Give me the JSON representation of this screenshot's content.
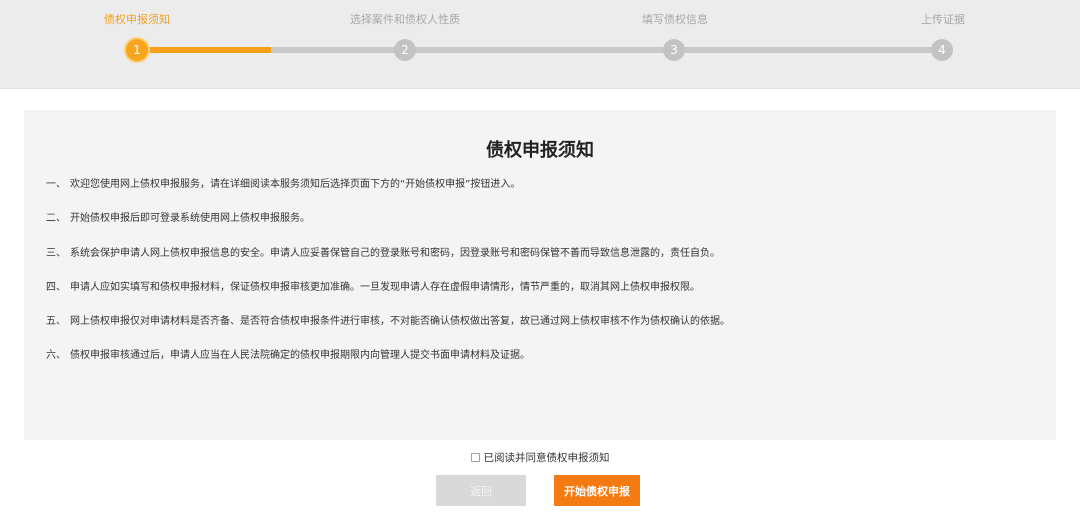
{
  "steps": [
    {
      "label": "债权申报须知",
      "num": "1"
    },
    {
      "label": "选择案件和债权人性质",
      "num": "2"
    },
    {
      "label": "填写债权信息",
      "num": "3"
    },
    {
      "label": "上传证据",
      "num": "4"
    }
  ],
  "current_step": 1,
  "notice": {
    "title": "债权申报须知",
    "items": [
      {
        "num": "一、",
        "text": "欢迎您使用网上债权申报服务，请在详细阅读本服务须知后选择页面下方的“开始债权申报”按钮进入。"
      },
      {
        "num": "二、",
        "text": "开始债权申报后即可登录系统使用网上债权申报服务。"
      },
      {
        "num": "三、",
        "text": "系统会保护申请人网上债权申报信息的安全。申请人应妥善保管自己的登录账号和密码，因登录账号和密码保管不善而导致信息泄露的，责任自负。"
      },
      {
        "num": "四、",
        "text": "申请人应如实填写和债权申报材料，保证债权申报审核更加准确。一旦发现申请人存在虚假申请情形，情节严重的，取消其网上债权申报权限。"
      },
      {
        "num": "五、",
        "text": "网上债权申报仅对申请材料是否齐备、是否符合债权申报条件进行审核，不对能否确认债权做出答复，故已通过网上债权审核不作为债权确认的依据。"
      },
      {
        "num": "六、",
        "text": "债权申报审核通过后，申请人应当在人民法院确定的债权申报期限内向管理人提交书面申请材料及证据。"
      }
    ]
  },
  "agree": {
    "label": "已阅读并同意债权申报须知",
    "checked": false
  },
  "buttons": {
    "back": "返回",
    "start": "开始债权申报"
  },
  "colors": {
    "accent": "#f47a12",
    "step_active": "#f6a51f",
    "step_inactive": "#c3c3c3"
  }
}
